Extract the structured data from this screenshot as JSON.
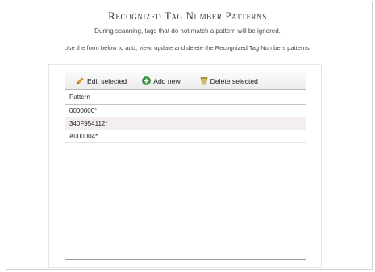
{
  "header": {
    "title": "Recognized Tag Number Patterns",
    "subtitle": "During scanning, tags that do not match a pattern will be ignored.",
    "instructions": "Use the form below to add, view, update and delete the Recognized Tag Numbers patterns."
  },
  "toolbar": {
    "edit_label": "Edit selected",
    "add_label": "Add new",
    "delete_label": "Delete selected"
  },
  "grid": {
    "column_header": "Pattern",
    "rows": [
      "0000000*",
      "340F954112*",
      "A000004*"
    ]
  },
  "colors": {
    "add_icon_green": "#2e9a3c",
    "edit_pencil": "#d9a21b",
    "row_alt_background": "#f5eef0"
  }
}
